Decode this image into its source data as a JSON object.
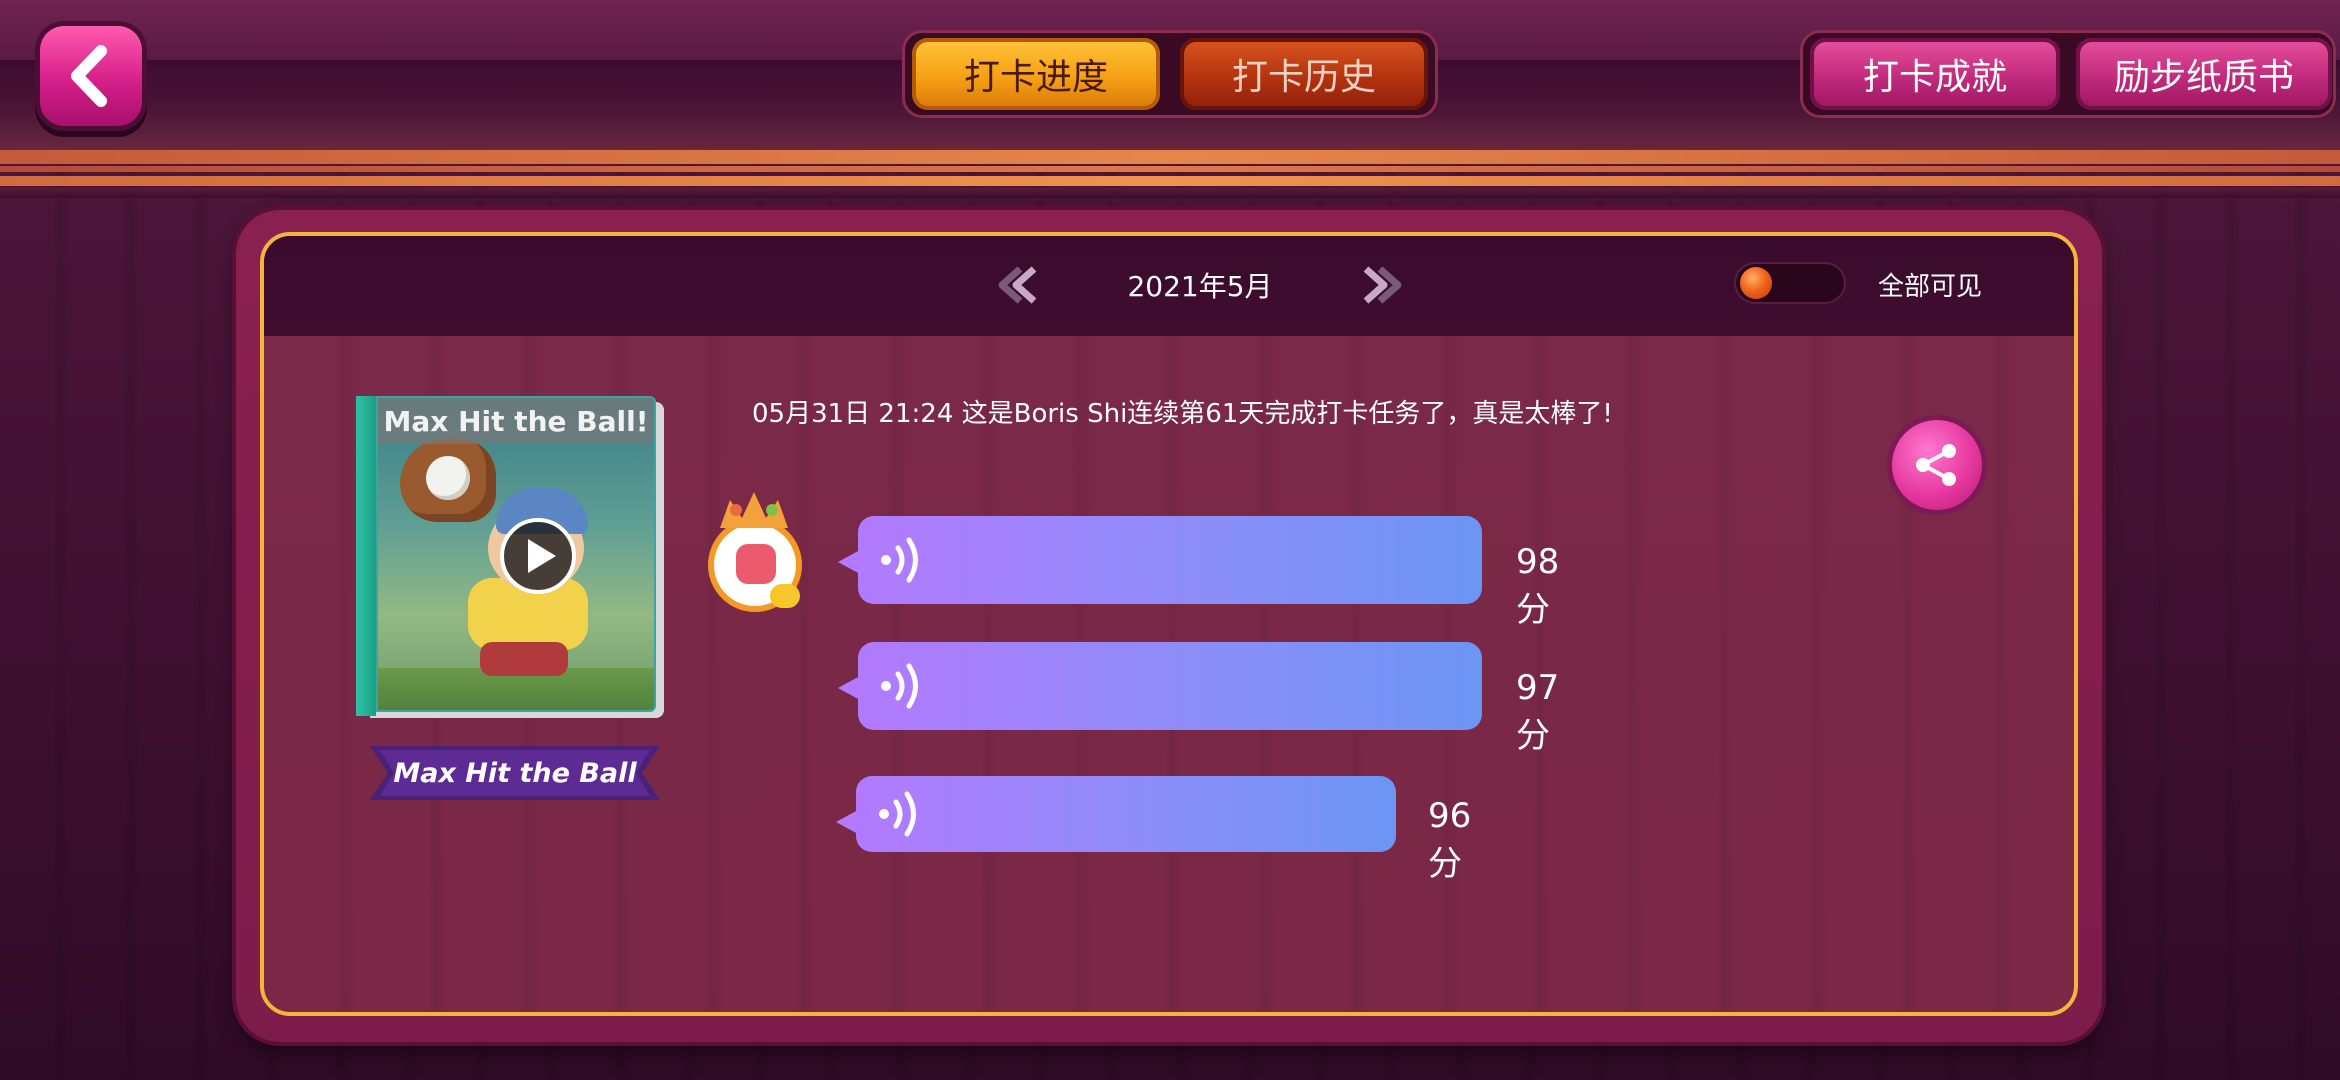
{
  "header": {
    "tabs": [
      {
        "label": "打卡进度",
        "active": true
      },
      {
        "label": "打卡历史",
        "active": false
      }
    ],
    "right_buttons": [
      "打卡成就",
      "励步纸质书"
    ]
  },
  "panel": {
    "month": "2021年5月",
    "visibility_label": "全部可见",
    "visibility_on": false
  },
  "book": {
    "cover_title": "Max Hit the Ball!",
    "ribbon_title": "Max Hit the Ball"
  },
  "entry": {
    "message": "05月31日 21:24 这是Boris Shi连续第61天完成打卡任务了，真是太棒了!",
    "recordings": [
      {
        "score": "98分"
      },
      {
        "score": "97分"
      },
      {
        "score": "96分"
      }
    ]
  },
  "colors": {
    "accent_orange": "#f6a014",
    "accent_pink": "#d61f8a",
    "bubble_start": "#b27afe",
    "bubble_end": "#6b95f4",
    "panel_border": "#f4b63a"
  },
  "icons": {
    "back": "chevron-left-icon",
    "prev_month": "double-chevron-left-icon",
    "next_month": "double-chevron-right-icon",
    "play": "play-icon",
    "sound": "sound-wave-icon",
    "share": "share-icon"
  }
}
